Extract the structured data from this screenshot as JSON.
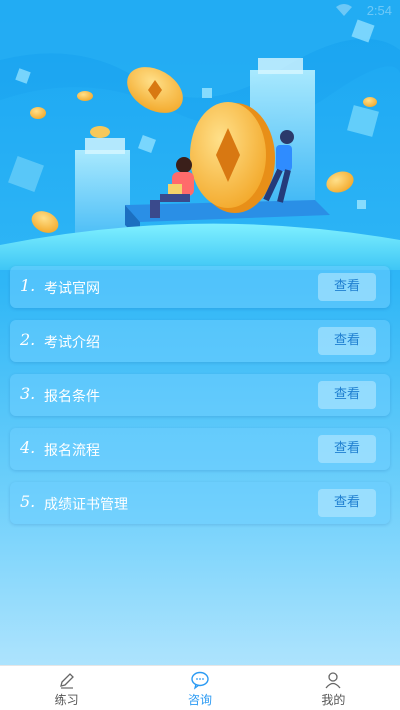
{
  "status_bar": {
    "time": "2:54"
  },
  "list": {
    "items": [
      {
        "num": "1.",
        "label": "考试官网",
        "button": "查看"
      },
      {
        "num": "2.",
        "label": "考试介绍",
        "button": "查看"
      },
      {
        "num": "3.",
        "label": "报名条件",
        "button": "查看"
      },
      {
        "num": "4.",
        "label": "报名流程",
        "button": "查看"
      },
      {
        "num": "5.",
        "label": "成绩证书管理",
        "button": "查看"
      }
    ]
  },
  "tabbar": {
    "items": [
      {
        "label": "练习",
        "icon": "pencil-icon",
        "active": false
      },
      {
        "label": "咨询",
        "icon": "chat-icon",
        "active": true
      },
      {
        "label": "我的",
        "icon": "user-icon",
        "active": false
      }
    ],
    "active_color": "#2b9af3"
  }
}
